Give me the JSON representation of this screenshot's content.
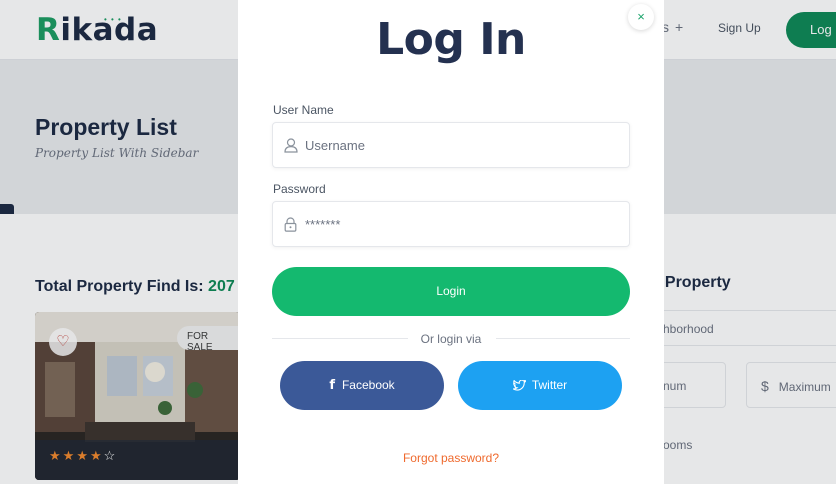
{
  "background": {
    "logo": {
      "first_letter": "R",
      "rest": "ikada",
      "dots": "• • •"
    },
    "nav": {
      "plus_suffix": "s",
      "plus": "+",
      "signup": "Sign Up",
      "login": "Log I"
    },
    "banner": {
      "title": "Property List",
      "subtitle": "Property List With Sidebar"
    },
    "results": {
      "label": "Total Property Find Is: ",
      "count": "207"
    },
    "card": {
      "badge": "FOR SALE",
      "rating": 4,
      "max_rating": 5
    },
    "sidebar": {
      "title": "w Property",
      "neighborhood_placeholder": "hborhood",
      "min_placeholder": "num",
      "max_currency": "$",
      "max_placeholder": "Maximum",
      "rooms_placeholder": "ooms"
    }
  },
  "modal": {
    "title": "Log In",
    "close": "×",
    "username": {
      "label": "User Name",
      "placeholder": "Username"
    },
    "password": {
      "label": "Password",
      "placeholder": "*******"
    },
    "submit": "Login",
    "or_text": "Or login via",
    "facebook": {
      "icon": "f",
      "label": "Facebook"
    },
    "twitter": {
      "label": "Twitter"
    },
    "forgot": "Forgot password?"
  },
  "colors": {
    "brand_green": "#14b96f",
    "dark_navy": "#243150",
    "facebook": "#3b5998",
    "twitter": "#1da1f2",
    "forgot_link": "#ef6a2e"
  },
  "icons": {
    "close": "close-icon",
    "username": "user-icon",
    "password": "lock-icon",
    "facebook": "facebook-icon",
    "twitter": "twitter-icon",
    "favorite": "heart-icon",
    "settings": "gear-icon",
    "rating": "star-icon"
  }
}
